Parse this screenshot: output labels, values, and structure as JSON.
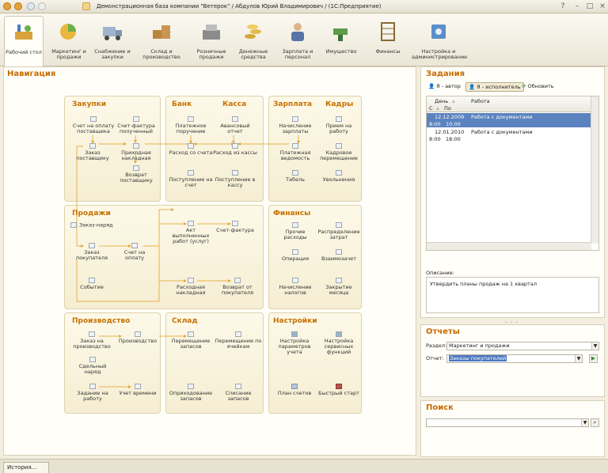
{
  "window": {
    "title": "Демонстрационная база компании \"Ветерок\" / Абдулов Юрий Владимирович / (1С:Предприятие)"
  },
  "sections": [
    {
      "label": "Рабочий стол",
      "icon": "desktop-icon"
    },
    {
      "label": "Маркетинг и продажи",
      "icon": "marketing-icon"
    },
    {
      "label": "Снабжение и закупки",
      "icon": "truck-icon"
    },
    {
      "label": "Склад и производство",
      "icon": "boxes-icon"
    },
    {
      "label": "Розничные продажи",
      "icon": "cash-register-icon"
    },
    {
      "label": "Денежные средства",
      "icon": "coins-icon"
    },
    {
      "label": "Зарплата и персонал",
      "icon": "person-icon"
    },
    {
      "label": "Имущество",
      "icon": "drill-icon"
    },
    {
      "label": "Финансы",
      "icon": "abacus-icon"
    },
    {
      "label": "Настройка и администрирование",
      "icon": "settings-icon"
    }
  ],
  "nav": {
    "title": "Навигация",
    "groups": {
      "zakupki": {
        "title": "Закупки",
        "items": [
          "Счет на оплату поставщика",
          "Счет-фактура полученный",
          "Заказ поставщику",
          "Приходная накладная",
          "Возврат поставщику"
        ]
      },
      "bank": {
        "title": "Банк",
        "items": [
          "Платежное поручение",
          "Расход со счета",
          "Поступление на счет"
        ]
      },
      "kassa": {
        "title": "Касса",
        "items": [
          "Авансовый отчет",
          "Расход из кассы",
          "Поступление в кассу"
        ]
      },
      "zarplata": {
        "title": "Зарплата",
        "items": [
          "Начисление зарплаты",
          "Платежная ведомость",
          "Табель"
        ]
      },
      "kadry": {
        "title": "Кадры",
        "items": [
          "Прием на работу",
          "Кадровое перемещение",
          "Увольнения"
        ]
      },
      "prodazhi": {
        "title": "Продажи",
        "items": [
          "Заказ-наряд",
          "Заказ покупателя",
          "Счет на оплату",
          "Событие",
          "Акт выполненных работ (услуг)",
          "Счет-фактура",
          "Расходная накладная",
          "Возврат от покупателя"
        ]
      },
      "finansy": {
        "title": "Финансы",
        "items": [
          "Прочие расходы",
          "Распределение затрат",
          "Операция",
          "Взаимозачет",
          "Начисление налогов",
          "Закрытие месяца"
        ]
      },
      "proizvodstvo": {
        "title": "Производство",
        "items": [
          "Заказ на производство",
          "Производство",
          "Сдельный наряд",
          "Задание на работу",
          "Учет времени"
        ]
      },
      "sklad": {
        "title": "Склад",
        "items": [
          "Перемещение запасов",
          "Перемещение по ячейкам",
          "Оприходование запасов",
          "Списание запасов"
        ]
      },
      "nastroyki": {
        "title": "Настройки",
        "items": [
          "Настройка параметров учета",
          "Настройка сервисных функций",
          "План счетов",
          "Быстрый старт"
        ]
      }
    }
  },
  "tasks": {
    "title": "Задания",
    "buttons": {
      "author": "Я - автор",
      "executor": "Я - исполнитель",
      "refresh": "Обновить"
    },
    "columns": {
      "day": "День",
      "work": "Работа",
      "from": "С",
      "to": "По"
    },
    "rows": [
      {
        "date": "12.12.2009",
        "from": "8:00",
        "to": "10:00",
        "work": "Работа с документами",
        "selected": true
      },
      {
        "date": "12.01.2010",
        "from": "8:00",
        "to": "18:00",
        "work": "Работа с документами",
        "selected": false
      }
    ],
    "description_label": "Описание:",
    "description": "Утвердить планы продаж на 1 квартал"
  },
  "reports": {
    "title": "Отчеты",
    "section_label": "Раздел:",
    "section_value": "Маркетинг и продажи",
    "report_label": "Отчет:",
    "report_value": "Заказы покупателей"
  },
  "search": {
    "title": "Поиск",
    "value": ""
  },
  "status": {
    "history_tab": "История..."
  },
  "colors": {
    "accent": "#c76b00",
    "selection": "#5b83bf"
  }
}
